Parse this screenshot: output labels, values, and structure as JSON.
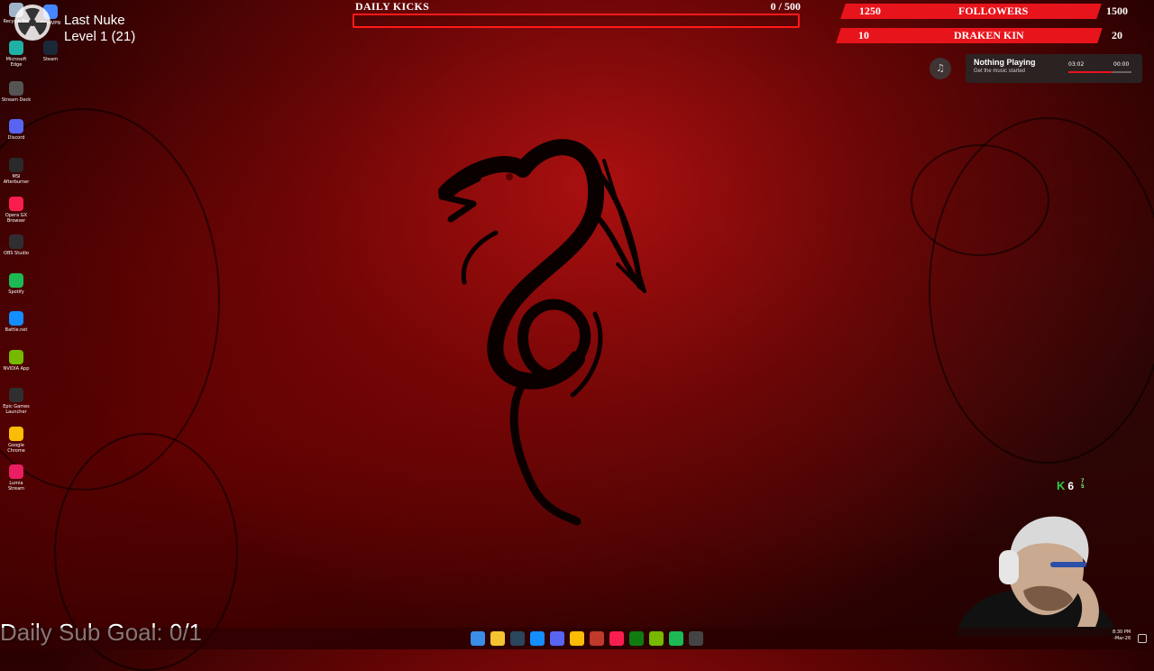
{
  "desktop": {
    "icons": [
      {
        "label": "Recycle Bin",
        "icon": "recycle-bin-icon",
        "color": "#9fb4c8"
      },
      {
        "label": "NordVPN",
        "icon": "nordvpn-icon",
        "color": "#4687ff"
      },
      {
        "label": "Microsoft Edge",
        "icon": "edge-icon",
        "color": "#1fb0a6"
      },
      {
        "label": "Steam",
        "icon": "steam-icon",
        "color": "#1b2838"
      },
      {
        "label": "Stream Deck",
        "icon": "stream-deck-icon",
        "color": "#555555"
      },
      {
        "label": "Discord",
        "icon": "discord-icon",
        "color": "#5865f2"
      },
      {
        "label": "MSI Afterburner",
        "icon": "afterburner-icon",
        "color": "#2a2a2a"
      },
      {
        "label": "Opera GX Browser",
        "icon": "opera-gx-icon",
        "color": "#fa1e4e"
      },
      {
        "label": "OBS Studio",
        "icon": "obs-icon",
        "color": "#302e31"
      },
      {
        "label": "Spotify",
        "icon": "spotify-icon",
        "color": "#1db954"
      },
      {
        "label": "Battle.net",
        "icon": "battlenet-icon",
        "color": "#148eff"
      },
      {
        "label": "NVIDIA App",
        "icon": "nvidia-icon",
        "color": "#76b900"
      },
      {
        "label": "Epic Games Launcher",
        "icon": "epic-games-icon",
        "color": "#2f2f2f"
      },
      {
        "label": "Google Chrome",
        "icon": "chrome-icon",
        "color": "#fbbc05"
      },
      {
        "label": "Lumia Stream",
        "icon": "lumia-stream-icon",
        "color": "#e91e63"
      }
    ]
  },
  "game": {
    "title": "Last Nuke",
    "level": "Level 1 (21)"
  },
  "daily_kicks": {
    "label": "DAILY KICKS",
    "count": "0  / 500",
    "progress": 0,
    "color": "#ff1a1a"
  },
  "goals": {
    "followers": {
      "current": "1250",
      "label": "FOLLOWERS",
      "target": "1500"
    },
    "draken": {
      "current": "10",
      "label": "DRAKEN KIN",
      "target": "20"
    },
    "color": "#e8141c"
  },
  "music": {
    "icon": "music-note-icon",
    "title": "Nothing Playing",
    "subtitle": "Get the music started",
    "elapsed": "03:02",
    "duration": "00:00",
    "progress": 0.7
  },
  "counter": {
    "icon": "kick-icon",
    "value": "6",
    "mini_top": "7",
    "mini_bottom": "5"
  },
  "sub_goal": "Daily Sub Goal: 0/1",
  "taskbar": {
    "icons": [
      {
        "icon": "windows-start-icon",
        "color": "#3a8ee6"
      },
      {
        "icon": "file-explorer-icon",
        "color": "#f4c430"
      },
      {
        "icon": "steam-icon",
        "color": "#2a475e"
      },
      {
        "icon": "battlenet-icon",
        "color": "#148eff"
      },
      {
        "icon": "discord-icon",
        "color": "#5865f2"
      },
      {
        "icon": "chrome-icon",
        "color": "#fbbc05"
      },
      {
        "icon": "afterburner-icon",
        "color": "#c0392b"
      },
      {
        "icon": "opera-gx-icon",
        "color": "#fa1e4e"
      },
      {
        "icon": "xbox-icon",
        "color": "#107c10"
      },
      {
        "icon": "nvidia-icon",
        "color": "#76b900"
      },
      {
        "icon": "spotify-icon",
        "color": "#1db954"
      },
      {
        "icon": "obs-icon",
        "color": "#444444"
      }
    ],
    "time": "8:30 PM",
    "date": "-Mar-26"
  }
}
